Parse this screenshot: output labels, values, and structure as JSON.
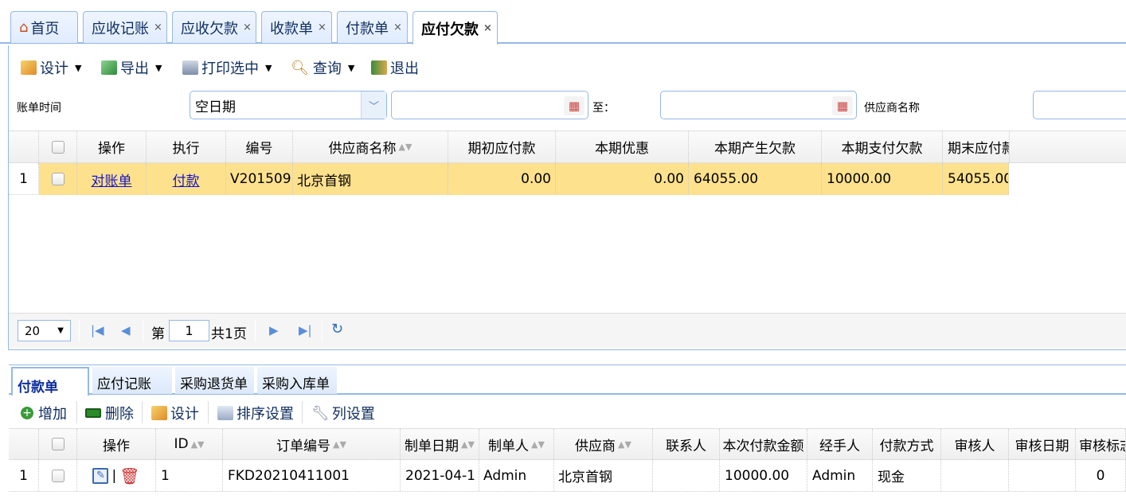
{
  "tabs": [
    {
      "label": "首页",
      "closable": false
    },
    {
      "label": "应收记账",
      "closable": true
    },
    {
      "label": "应收欠款",
      "closable": true
    },
    {
      "label": "收款单",
      "closable": true
    },
    {
      "label": "付款单",
      "closable": true
    },
    {
      "label": "应付欠款",
      "closable": true,
      "active": true
    }
  ],
  "close_glyph": "×",
  "toolbar": {
    "design": "设计",
    "export": "导出",
    "print": "打印选中",
    "query": "查询",
    "exit": "退出"
  },
  "filter": {
    "bill_time_label": "账单时间",
    "date_type_value": "空日期",
    "date_from_value": "",
    "to_label": "至：",
    "date_to_value": "",
    "supplier_label": "供应商名称",
    "supplier_value": ""
  },
  "grid": {
    "headers": [
      "操作",
      "执行",
      "编号",
      "供应商名称",
      "期初应付款",
      "本期优惠",
      "本期产生欠款",
      "本期支付欠款",
      "期末应付款"
    ],
    "rows": [
      {
        "num": "1",
        "op": "对账单",
        "exec": "付款",
        "code": "V201509",
        "supplier": "北京首钢",
        "opening": "0.00",
        "discount": "0.00",
        "incurred": "64055.00",
        "paid": "10000.00",
        "closing": "54055.00"
      }
    ]
  },
  "pager": {
    "page_size": "20",
    "page_prefix": "第",
    "page_value": "1",
    "page_total": "共1页"
  },
  "subtabs": [
    "付款单",
    "应付记账",
    "采购退货单",
    "采购入库单"
  ],
  "subtoolbar": {
    "add": "增加",
    "delete": "删除",
    "design": "设计",
    "sort": "排序设置",
    "columns": "列设置"
  },
  "subgrid": {
    "headers": [
      "操作",
      "ID",
      "订单编号",
      "制单日期",
      "制单人",
      "供应商",
      "联系人",
      "本次付款金额",
      "经手人",
      "付款方式",
      "审核人",
      "审核日期",
      "审核标志"
    ],
    "rows": [
      {
        "num": "1",
        "id": "1",
        "order_no": "FKD20210411001",
        "date": "2021-04-1",
        "maker": "Admin",
        "supplier": "北京首钢",
        "contact": "",
        "amount": "10000.00",
        "handler": "Admin",
        "method": "现金",
        "auditor": "",
        "audit_date": "",
        "audit_flag": "0"
      }
    ]
  },
  "colors": {
    "accent": "#95b8e7",
    "selected_row": "#fee18d",
    "link": "#1515c4"
  }
}
